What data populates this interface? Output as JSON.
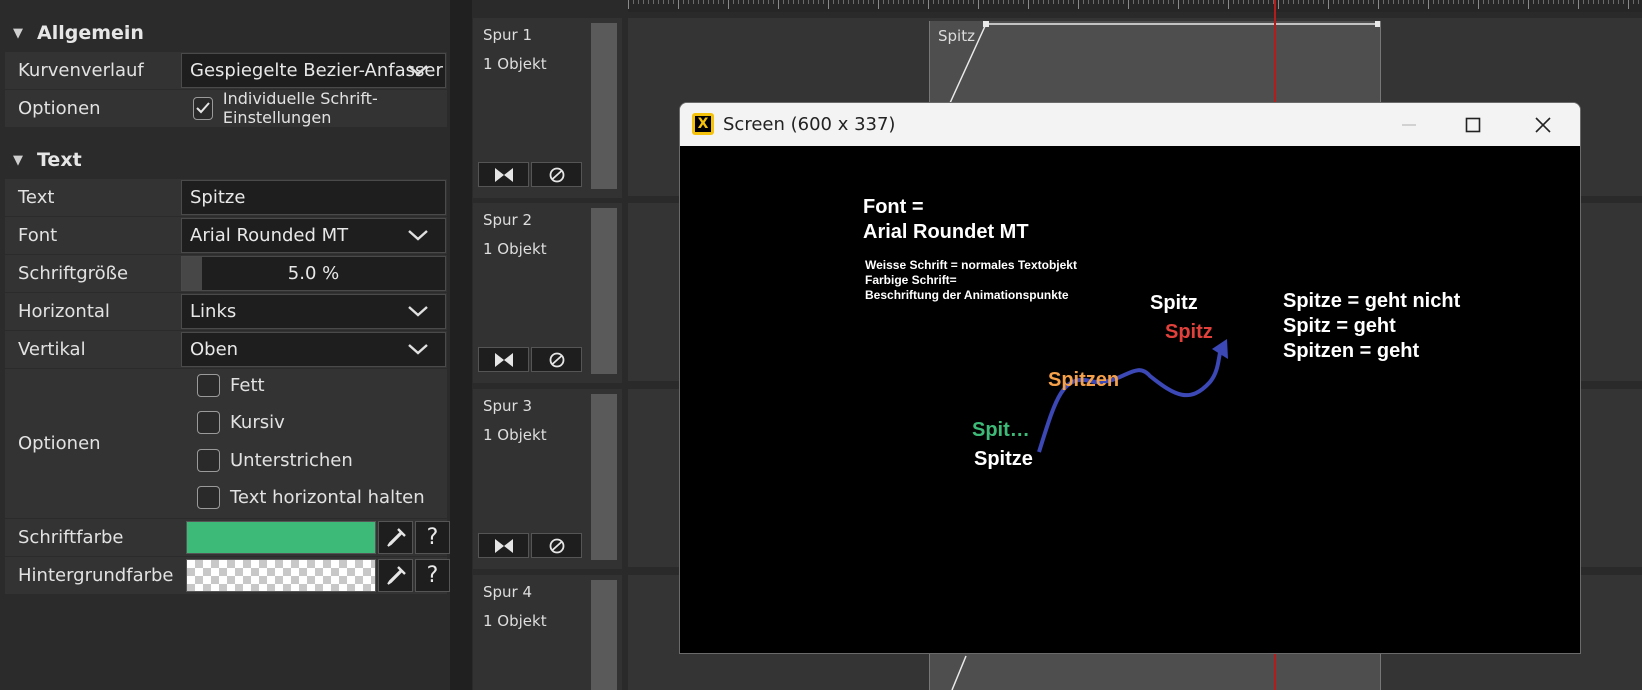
{
  "properties": {
    "allgemein": {
      "title": "Allgemein",
      "rows": [
        {
          "label": "Kurvenverlauf",
          "value": "Gespiegelte Bezier-Anfasser"
        },
        {
          "label": "Optionen",
          "checkbox_label": "Individuelle Schrift-Einstellungen",
          "checked": true
        }
      ]
    },
    "text": {
      "title": "Text",
      "text_label": "Text",
      "text_value": "Spitze",
      "font_label": "Font",
      "font_value": "Arial Rounded MT",
      "size_label": "Schriftgröße",
      "size_value": "5.0 %",
      "horizontal_label": "Horizontal",
      "horizontal_value": "Links",
      "vertical_label": "Vertikal",
      "vertical_value": "Oben",
      "options_label": "Optionen",
      "options": [
        {
          "label": "Fett",
          "checked": false
        },
        {
          "label": "Kursiv",
          "checked": false
        },
        {
          "label": "Unterstrichen",
          "checked": false
        },
        {
          "label": "Text horizontal halten",
          "checked": false
        }
      ],
      "font_color_label": "Schriftfarbe",
      "font_color": "#3dba78",
      "bg_color_label": "Hintergrundfarbe",
      "bg_color": "transparent",
      "help_label": "?"
    }
  },
  "tracks": [
    {
      "name": "Spur 1",
      "count": "1 Objekt"
    },
    {
      "name": "Spur 2",
      "count": "1 Objekt"
    },
    {
      "name": "Spur 3",
      "count": "1 Objekt"
    },
    {
      "name": "Spur 4",
      "count": "1 Objekt"
    }
  ],
  "timeline": {
    "clip_label": "Spitz",
    "playhead_color": "#b31c1c"
  },
  "screen_window": {
    "title": "Screen (600 x 337)",
    "app_icon_glyph": "X",
    "canvas": {
      "font_line1": "Font =",
      "font_line2": "Arial Roundet MT",
      "note_line1": "Weisse Schrift = normales Textobjekt",
      "note_line2": "Farbige Schrift=",
      "note_line3": "Beschriftung der Animationspunkte",
      "white_spitz": "Spitz",
      "red_spitz": "Spitz",
      "orange_spitzen": "Spitzen",
      "green_spit": "Spit…",
      "white_spitze": "Spitze",
      "result_line1": "Spitze = geht nicht",
      "result_line2": "Spitz = geht",
      "result_line3": "Spitzen = geht",
      "colors": {
        "green": "#3dba78",
        "orange": "#f5a04a",
        "red": "#e2403b",
        "curve": "#3b48b5"
      }
    }
  }
}
